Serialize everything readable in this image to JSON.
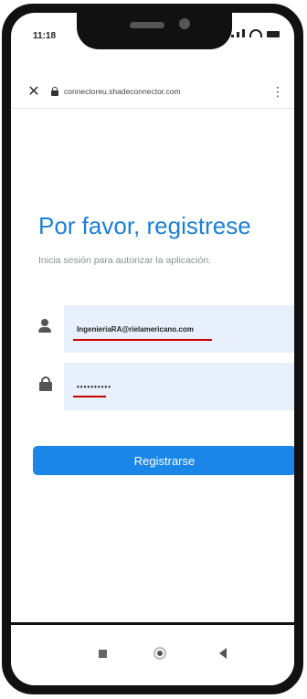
{
  "status_bar": {
    "time": "11:18"
  },
  "browser": {
    "url": "connectoreu.shadeconnector.com",
    "close_icon": "✕",
    "menu_icon": "⋮"
  },
  "login": {
    "title": "Por favor, registrese",
    "subtitle": "Inicia sesión para autorizar la aplicación.",
    "email_value": "IngenieriaRA@rielamericano.com",
    "password_value": "••••••••••",
    "submit_label": "Registrarse"
  },
  "colors": {
    "accent": "#1a86e8",
    "title": "#1e7fd6",
    "field_bg": "#e9f0fd",
    "annotation": "#cc0000"
  }
}
